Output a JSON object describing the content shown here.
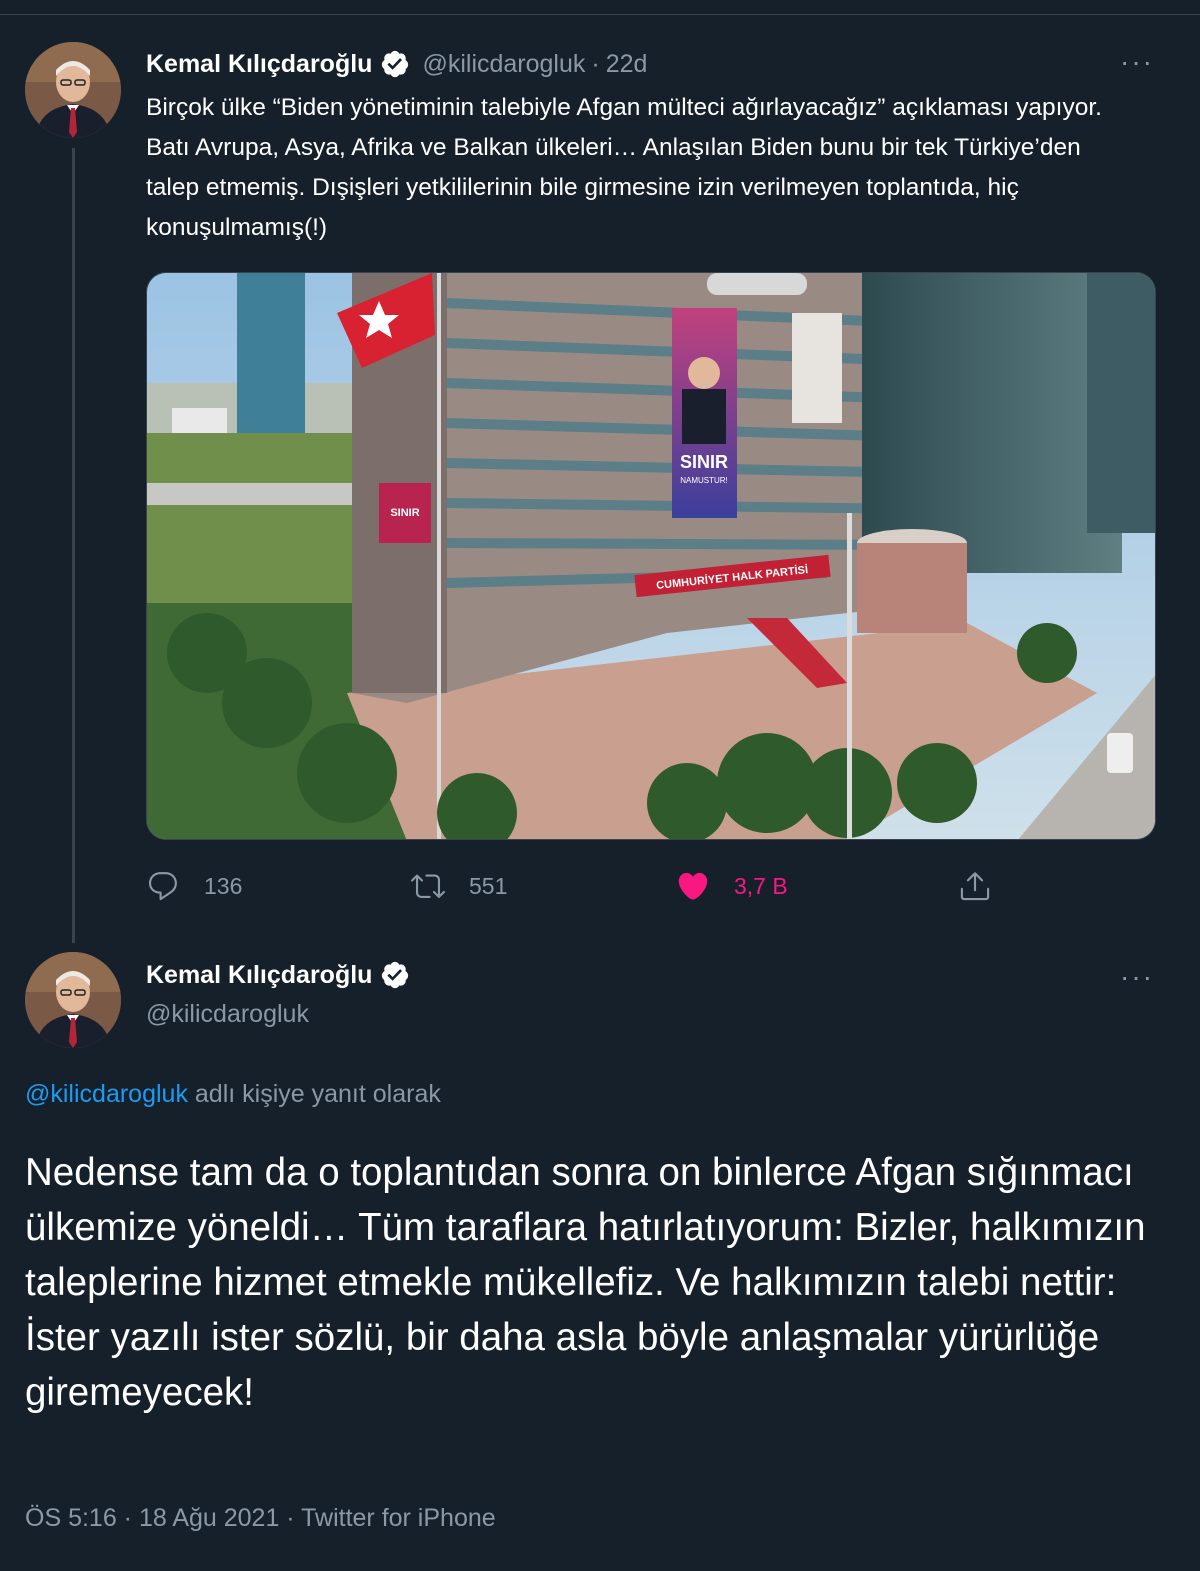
{
  "tweet1": {
    "author_name": "Kemal Kılıçdaroğlu",
    "handle": "@kilicdarogluk",
    "separator": "·",
    "time": "22d",
    "more": "···",
    "text": "Birçok ülke “Biden yönetiminin talebiyle Afgan mülteci ağırlayacağız” açıklaması yapıyor. Batı Avrupa, Asya, Afrika ve Balkan ülkeleri… Anlaşılan Biden bunu bir tek Türkiye’den talep etmemiş. Dışişleri yetkililerinin bile girmesine izin verilmeyen toplantıda, hiç konuşulmamış(!)",
    "media": {
      "banner_title": "SINIR",
      "banner_subtitle": "NAMUSTUR!",
      "facade_sign": "CUMHURİYET HALK PARTİSİ",
      "small_banner": "SINIR"
    },
    "actions": {
      "reply_count": "136",
      "retweet_count": "551",
      "like_count": "3,7 B"
    }
  },
  "tweet2": {
    "author_name": "Kemal Kılıçdaroğlu",
    "handle": "@kilicdarogluk",
    "more": "···",
    "reply_to_handle": "@kilicdarogluk",
    "reply_to_suffix": " adlı kişiye yanıt olarak",
    "text": "Nedense tam da o toplantıdan sonra on binlerce Afgan sığınmacı ülkemize yöneldi… Tüm taraflara hatırlatıyorum: Bizler, halkımızın taleplerine hizmet etmekle mükellefiz. Ve halkımızın talebi nettir: İster yazılı ister sözlü, bir daha asla böyle anlaşmalar yürürlüğe giremeyecek!",
    "meta": "ÖS 5:16 · 18 Ağu 2021 · Twitter for iPhone"
  },
  "colors": {
    "background": "#15202b",
    "secondary_text": "#8b98a5",
    "link": "#1d9bf0",
    "like": "#f91880",
    "divider": "#38444d"
  }
}
